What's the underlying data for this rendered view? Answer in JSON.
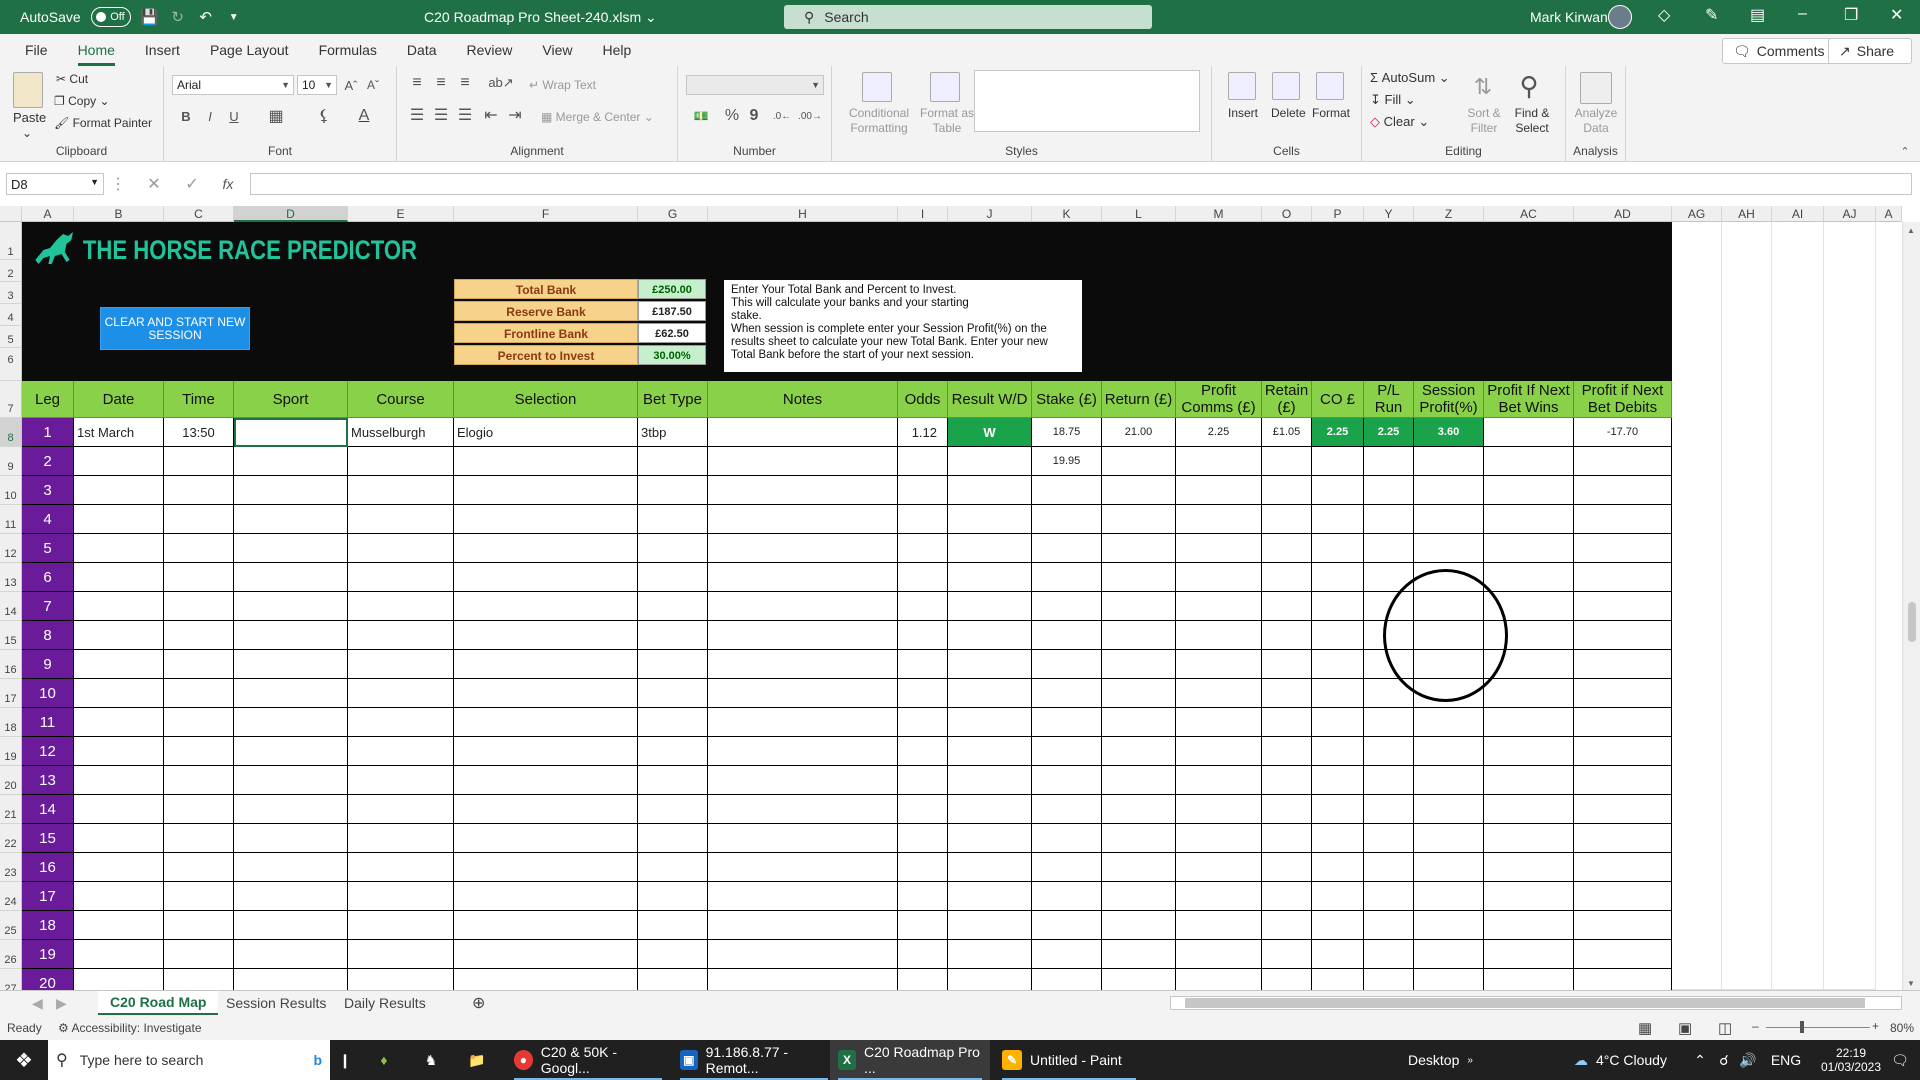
{
  "titlebar": {
    "autosave_label": "AutoSave",
    "autosave_state": "Off",
    "document_title": "C20 Roadmap Pro Sheet-240.xlsm",
    "search_placeholder": "Search",
    "user_name": "Mark Kirwan"
  },
  "menu": {
    "tabs": [
      "File",
      "Home",
      "Insert",
      "Page Layout",
      "Formulas",
      "Data",
      "Review",
      "View",
      "Help"
    ],
    "active_tab": "Home",
    "comments_label": "Comments",
    "share_label": "Share"
  },
  "ribbon": {
    "clipboard": {
      "label": "Clipboard",
      "paste": "Paste",
      "cut": "Cut",
      "copy": "Copy",
      "format_painter": "Format Painter"
    },
    "font": {
      "label": "Font",
      "font_name": "Arial",
      "font_size": "10"
    },
    "alignment": {
      "label": "Alignment",
      "wrap_text": "Wrap Text",
      "merge_center": "Merge & Center"
    },
    "number": {
      "label": "Number"
    },
    "styles": {
      "label": "Styles",
      "conditional": "Conditional Formatting",
      "format_table": "Format as Table"
    },
    "cells": {
      "label": "Cells",
      "insert": "Insert",
      "delete": "Delete",
      "format": "Format"
    },
    "editing": {
      "label": "Editing",
      "autosum": "AutoSum",
      "fill": "Fill",
      "clear": "Clear",
      "sort_filter": "Sort & Filter",
      "find_select": "Find & Select"
    },
    "analysis": {
      "label": "Analysis",
      "analyze_data": "Analyze Data"
    }
  },
  "formula_bar": {
    "name_box": "D8",
    "formula": ""
  },
  "columns": [
    "A",
    "B",
    "C",
    "D",
    "E",
    "F",
    "G",
    "H",
    "I",
    "J",
    "K",
    "L",
    "M",
    "O",
    "P",
    "Y",
    "Z",
    "AC",
    "AD",
    "AG",
    "AH",
    "AI",
    "AJ",
    "A"
  ],
  "selected_column": "D",
  "rows": [
    "1",
    "2",
    "3",
    "4",
    "5",
    "6",
    "7",
    "8",
    "9",
    "10",
    "11",
    "12",
    "13",
    "14",
    "15",
    "16",
    "17",
    "18",
    "19",
    "20",
    "21",
    "22",
    "23",
    "24",
    "25",
    "26",
    "27"
  ],
  "selected_row": "8",
  "banner": {
    "logo_text": "THE HORSE RACE PREDICTOR",
    "clear_button": "CLEAR AND START NEW SESSION",
    "bank": [
      {
        "label": "Total Bank",
        "value": "£250.00"
      },
      {
        "label": "Reserve Bank",
        "value": "£187.50"
      },
      {
        "label": "Frontline Bank",
        "value": "£62.50"
      },
      {
        "label": "Percent to Invest",
        "value": "30.00%"
      }
    ],
    "info_lines": [
      "Enter Your Total Bank and Percent to Invest.",
      "This will calculate your banks and your starting",
      "stake.",
      "When session is complete enter your Session Profit(%) on the",
      "results sheet to calculate your new Total Bank. Enter your new",
      "Total Bank before the start of your next session."
    ]
  },
  "table": {
    "headers": [
      "Leg",
      "Date",
      "Time",
      "Sport",
      "Course",
      "Selection",
      "Bet Type",
      "Notes",
      "Odds",
      "Result W/D",
      "Stake (£)",
      "Return (£)",
      "Profit Comms (£)",
      "Retain (£)",
      "CO £",
      "P/L Run",
      "Session Profit(%)",
      "Profit If Next Bet Wins",
      "Profit if Next Bet Debits"
    ],
    "row1": [
      "1",
      "1st March",
      "13:50",
      "",
      "Musselburgh",
      "Elogio",
      "3tbp",
      "",
      "1.12",
      "W",
      "18.75",
      "21.00",
      "2.25",
      "£1.05",
      "2.25",
      "2.25",
      "3.60",
      "",
      "-17.70"
    ],
    "row2_stake": "19.95",
    "legs": [
      "2",
      "3",
      "4",
      "5",
      "6",
      "7",
      "8",
      "9",
      "10",
      "11",
      "12",
      "13",
      "14",
      "15",
      "16",
      "17",
      "18",
      "19",
      "20"
    ]
  },
  "sheet_tabs": [
    "C20 Road Map",
    "Session Results",
    "Daily Results"
  ],
  "active_sheet": "C20 Road Map",
  "statusbar": {
    "ready": "Ready",
    "accessibility": "Accessibility: Investigate",
    "zoom": "80%"
  },
  "taskbar": {
    "search_placeholder": "Type here to search",
    "apps": [
      "C20 & 50K - Googl...",
      "91.186.8.77 - Remot...",
      "C20 Roadmap Pro ...",
      "Untitled - Paint"
    ],
    "desktop_label": "Desktop",
    "weather": "4°C  Cloudy",
    "language": "ENG",
    "time": "22:19",
    "date": "01/03/2023"
  },
  "colors": {
    "excel_green": "#1f7145",
    "header_green": "#8ad14a",
    "leg_purple": "#6a1b9a",
    "result_green": "#1aa34a",
    "logo_teal": "#21c49a"
  }
}
